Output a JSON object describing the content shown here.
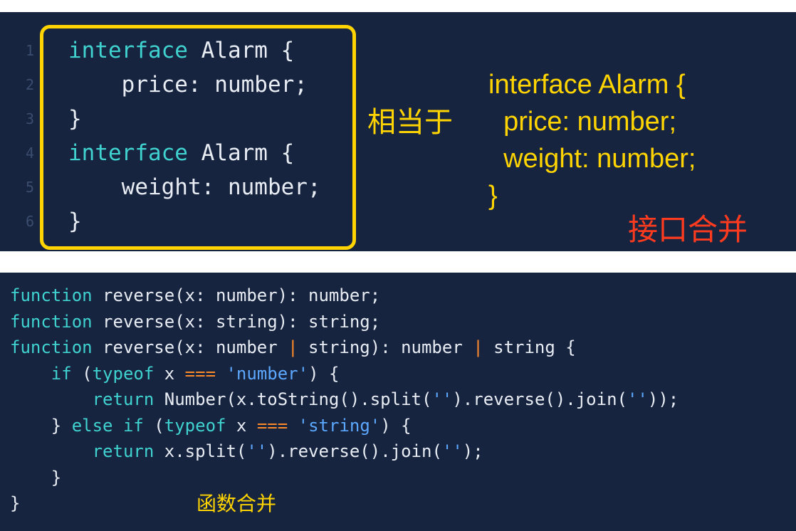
{
  "top_panel": {
    "line_numbers": [
      "1",
      "2",
      "3",
      "4",
      "5",
      "6"
    ],
    "code_lines": [
      [
        {
          "t": "interface",
          "c": "kw"
        },
        {
          "t": " Alarm {",
          "c": "fn"
        }
      ],
      [
        {
          "t": "    price: number;",
          "c": "fn"
        }
      ],
      [
        {
          "t": "}",
          "c": "fn"
        }
      ],
      [
        {
          "t": "interface",
          "c": "kw"
        },
        {
          "t": " Alarm {",
          "c": "fn"
        }
      ],
      [
        {
          "t": "    weight: number;",
          "c": "fn"
        }
      ],
      [
        {
          "t": "}",
          "c": "fn"
        }
      ]
    ],
    "equivalent_label": "相当于",
    "merged_interface": [
      "interface Alarm {",
      "  price: number;",
      "  weight: number;",
      "}"
    ],
    "merge_label": "接口合并"
  },
  "bottom_panel": {
    "code_lines": [
      [
        {
          "t": "function",
          "c": "kw"
        },
        {
          "t": " reverse(x: number): number;",
          "c": "fn"
        }
      ],
      [
        {
          "t": "function",
          "c": "kw"
        },
        {
          "t": " reverse(x: string): string;",
          "c": "fn"
        }
      ],
      [
        {
          "t": "function",
          "c": "kw"
        },
        {
          "t": " reverse(x: number ",
          "c": "fn"
        },
        {
          "t": "|",
          "c": "op"
        },
        {
          "t": " string): number ",
          "c": "fn"
        },
        {
          "t": "|",
          "c": "op"
        },
        {
          "t": " string {",
          "c": "fn"
        }
      ],
      [
        {
          "t": "    ",
          "c": "fn"
        },
        {
          "t": "if",
          "c": "kw"
        },
        {
          "t": " (",
          "c": "fn"
        },
        {
          "t": "typeof",
          "c": "kw"
        },
        {
          "t": " x ",
          "c": "fn"
        },
        {
          "t": "===",
          "c": "op"
        },
        {
          "t": " ",
          "c": "fn"
        },
        {
          "t": "'number'",
          "c": "str"
        },
        {
          "t": ") {",
          "c": "fn"
        }
      ],
      [
        {
          "t": "        ",
          "c": "fn"
        },
        {
          "t": "return",
          "c": "kw"
        },
        {
          "t": " Number(x.toString().split(",
          "c": "fn"
        },
        {
          "t": "''",
          "c": "str"
        },
        {
          "t": ").reverse().join(",
          "c": "fn"
        },
        {
          "t": "''",
          "c": "str"
        },
        {
          "t": "));",
          "c": "fn"
        }
      ],
      [
        {
          "t": "    } ",
          "c": "fn"
        },
        {
          "t": "else if",
          "c": "kw"
        },
        {
          "t": " (",
          "c": "fn"
        },
        {
          "t": "typeof",
          "c": "kw"
        },
        {
          "t": " x ",
          "c": "fn"
        },
        {
          "t": "===",
          "c": "op"
        },
        {
          "t": " ",
          "c": "fn"
        },
        {
          "t": "'string'",
          "c": "str"
        },
        {
          "t": ") {",
          "c": "fn"
        }
      ],
      [
        {
          "t": "        ",
          "c": "fn"
        },
        {
          "t": "return",
          "c": "kw"
        },
        {
          "t": " x.split(",
          "c": "fn"
        },
        {
          "t": "''",
          "c": "str"
        },
        {
          "t": ").reverse().join(",
          "c": "fn"
        },
        {
          "t": "''",
          "c": "str"
        },
        {
          "t": ");",
          "c": "fn"
        }
      ],
      [
        {
          "t": "    }",
          "c": "fn"
        }
      ],
      [
        {
          "t": "}",
          "c": "fn"
        }
      ]
    ],
    "function_merge_label": "函数合并"
  },
  "colors": {
    "panel_bg": "#172440",
    "keyword": "#3fd2cf",
    "string": "#5ca8ff",
    "operator": "#ff8a2a",
    "highlight_yellow": "#ffd400",
    "label_red": "#ff3b1f"
  }
}
